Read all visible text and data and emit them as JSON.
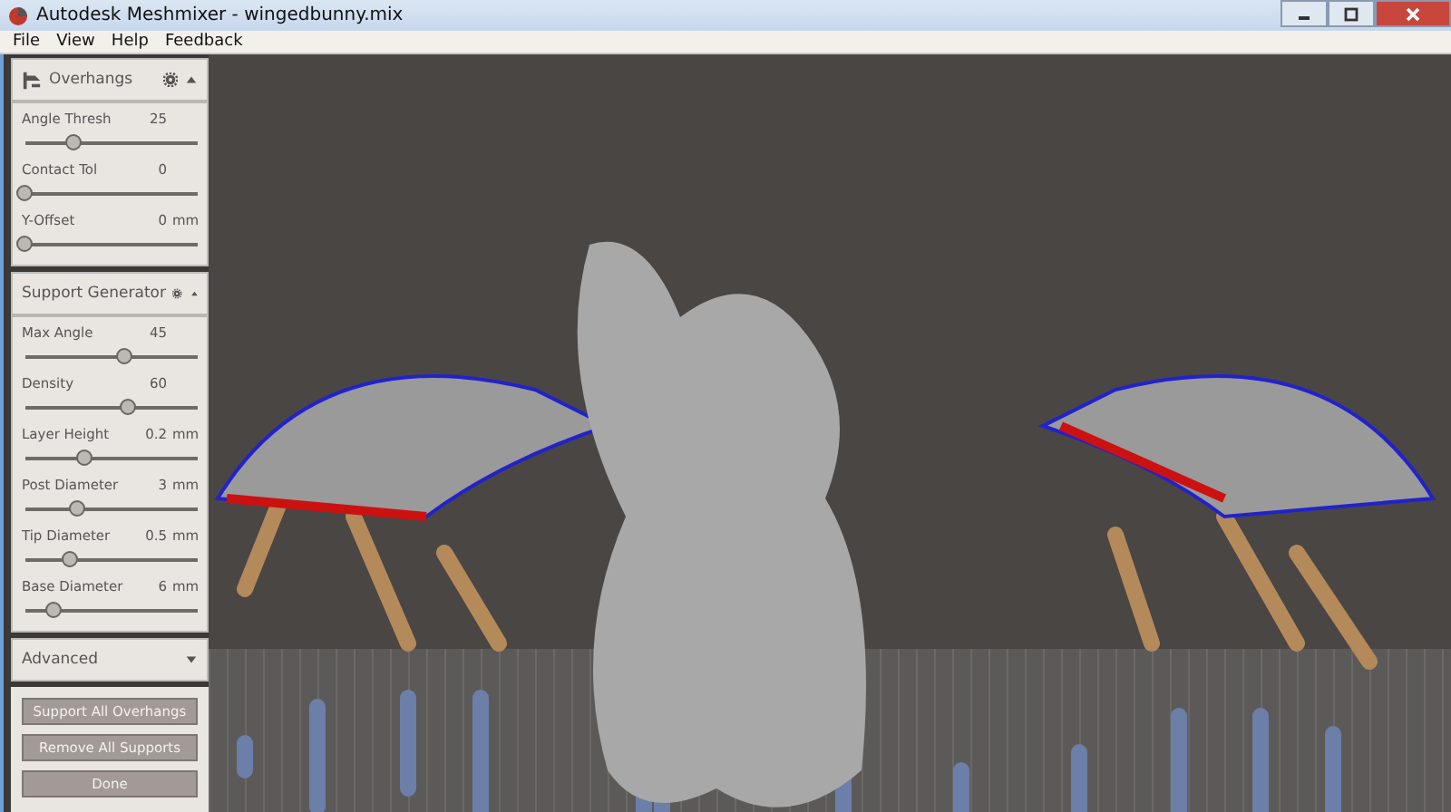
{
  "window": {
    "title": "Autodesk Meshmixer - wingedbunny.mix"
  },
  "menu": [
    "File",
    "View",
    "Help",
    "Feedback"
  ],
  "panels": [
    {
      "title": "Overhangs",
      "has_icon": true,
      "expanded": true,
      "sliders": [
        {
          "label": "Angle Thresh",
          "value": "25",
          "level": 0.28
        },
        {
          "label": "Contact Tol",
          "value": "0",
          "level": 0
        },
        {
          "label": "Y-Offset",
          "value": "0",
          "unit": "mm",
          "level": 0
        }
      ]
    },
    {
      "title": "Support Generator",
      "has_icon": false,
      "expanded": true,
      "sliders": [
        {
          "label": "Max Angle",
          "value": "45",
          "level": 0.58
        },
        {
          "label": "Density",
          "value": "60",
          "level": 0.6
        },
        {
          "label": "Layer Height",
          "value": "0.2",
          "unit": "mm",
          "level": 0.35
        },
        {
          "label": "Post Diameter",
          "value": "3",
          "unit": "mm",
          "level": 0.3
        },
        {
          "label": "Tip Diameter",
          "value": "0.5",
          "unit": "mm",
          "level": 0.26
        },
        {
          "label": "Base Diameter",
          "value": "6",
          "unit": "mm",
          "level": 0.17
        }
      ]
    },
    {
      "title": "Advanced",
      "has_icon": false,
      "expanded": false
    }
  ],
  "buttons": [
    "Support All Overhangs",
    "Remove All Supports",
    "Done"
  ]
}
